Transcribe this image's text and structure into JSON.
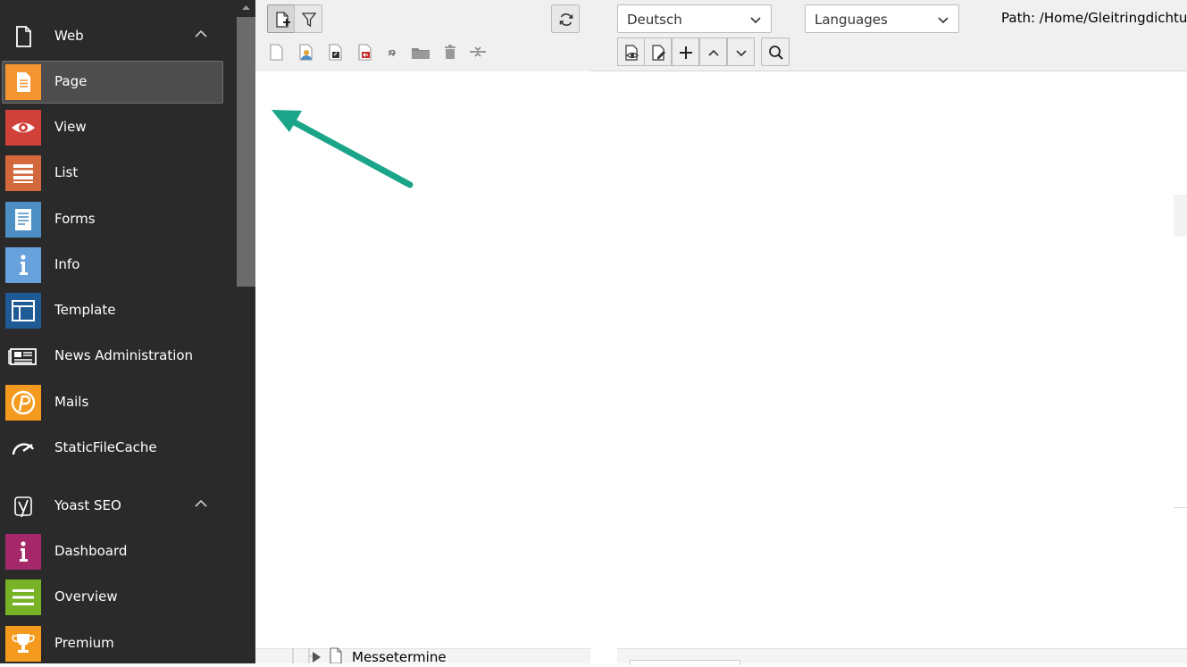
{
  "sidebar": {
    "web_group": {
      "label": "Web"
    },
    "web_modules": [
      {
        "label": "Page",
        "color": "#f49532"
      },
      {
        "label": "View",
        "color": "#d0413a"
      },
      {
        "label": "List",
        "color": "#d4683d"
      },
      {
        "label": "Forms",
        "color": "#4d8fc4"
      },
      {
        "label": "Info",
        "color": "#68a2dd"
      },
      {
        "label": "Template",
        "color": "#1e5a94"
      },
      {
        "label": "News Administration",
        "color": "#2a2a2a"
      },
      {
        "label": "Mails",
        "color": "#f49a1e"
      },
      {
        "label": "StaticFileCache",
        "color": "#2a2a2a"
      }
    ],
    "yoast_group": {
      "label": "Yoast SEO"
    },
    "yoast_modules": [
      {
        "label": "Dashboard",
        "color": "#a4286a"
      },
      {
        "label": "Overview",
        "color": "#77b227"
      },
      {
        "label": "Premium",
        "color": "#f49a1e"
      }
    ]
  },
  "tree": {
    "nodes": [
      {
        "label": "Messetermine"
      }
    ]
  },
  "docheader": {
    "language_select": "Deutsch",
    "languages_select": "Languages",
    "path": "Path: /Home/Gleitringdichtu"
  },
  "colors": {
    "sidebar_bg": "#2a2a2a",
    "active_module_bg": "#4d4d4d",
    "arrow": "#1aa589"
  }
}
